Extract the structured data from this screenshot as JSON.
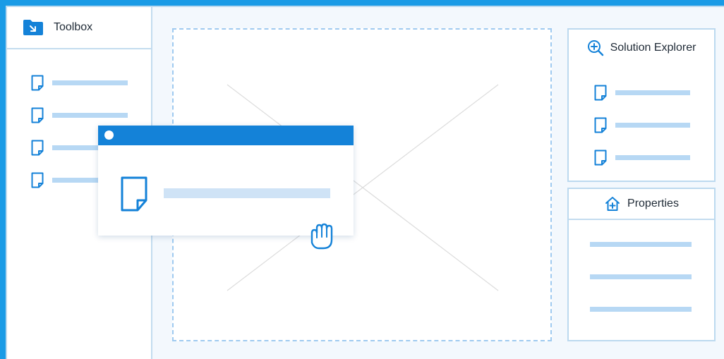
{
  "toolbox": {
    "title": "Toolbox",
    "icon": "folder-arrow-icon",
    "item_count_visible": 4
  },
  "solution_explorer": {
    "title": "Solution Explorer",
    "icon": "zoom-in-icon"
  },
  "properties": {
    "title": "Properties",
    "icon": "home-plus-icon"
  },
  "colors": {
    "accent": "#1482d8",
    "frame": "#1a9be6",
    "placeholder_line": "#b7d8f4",
    "panel_border": "#bcd9ef"
  }
}
